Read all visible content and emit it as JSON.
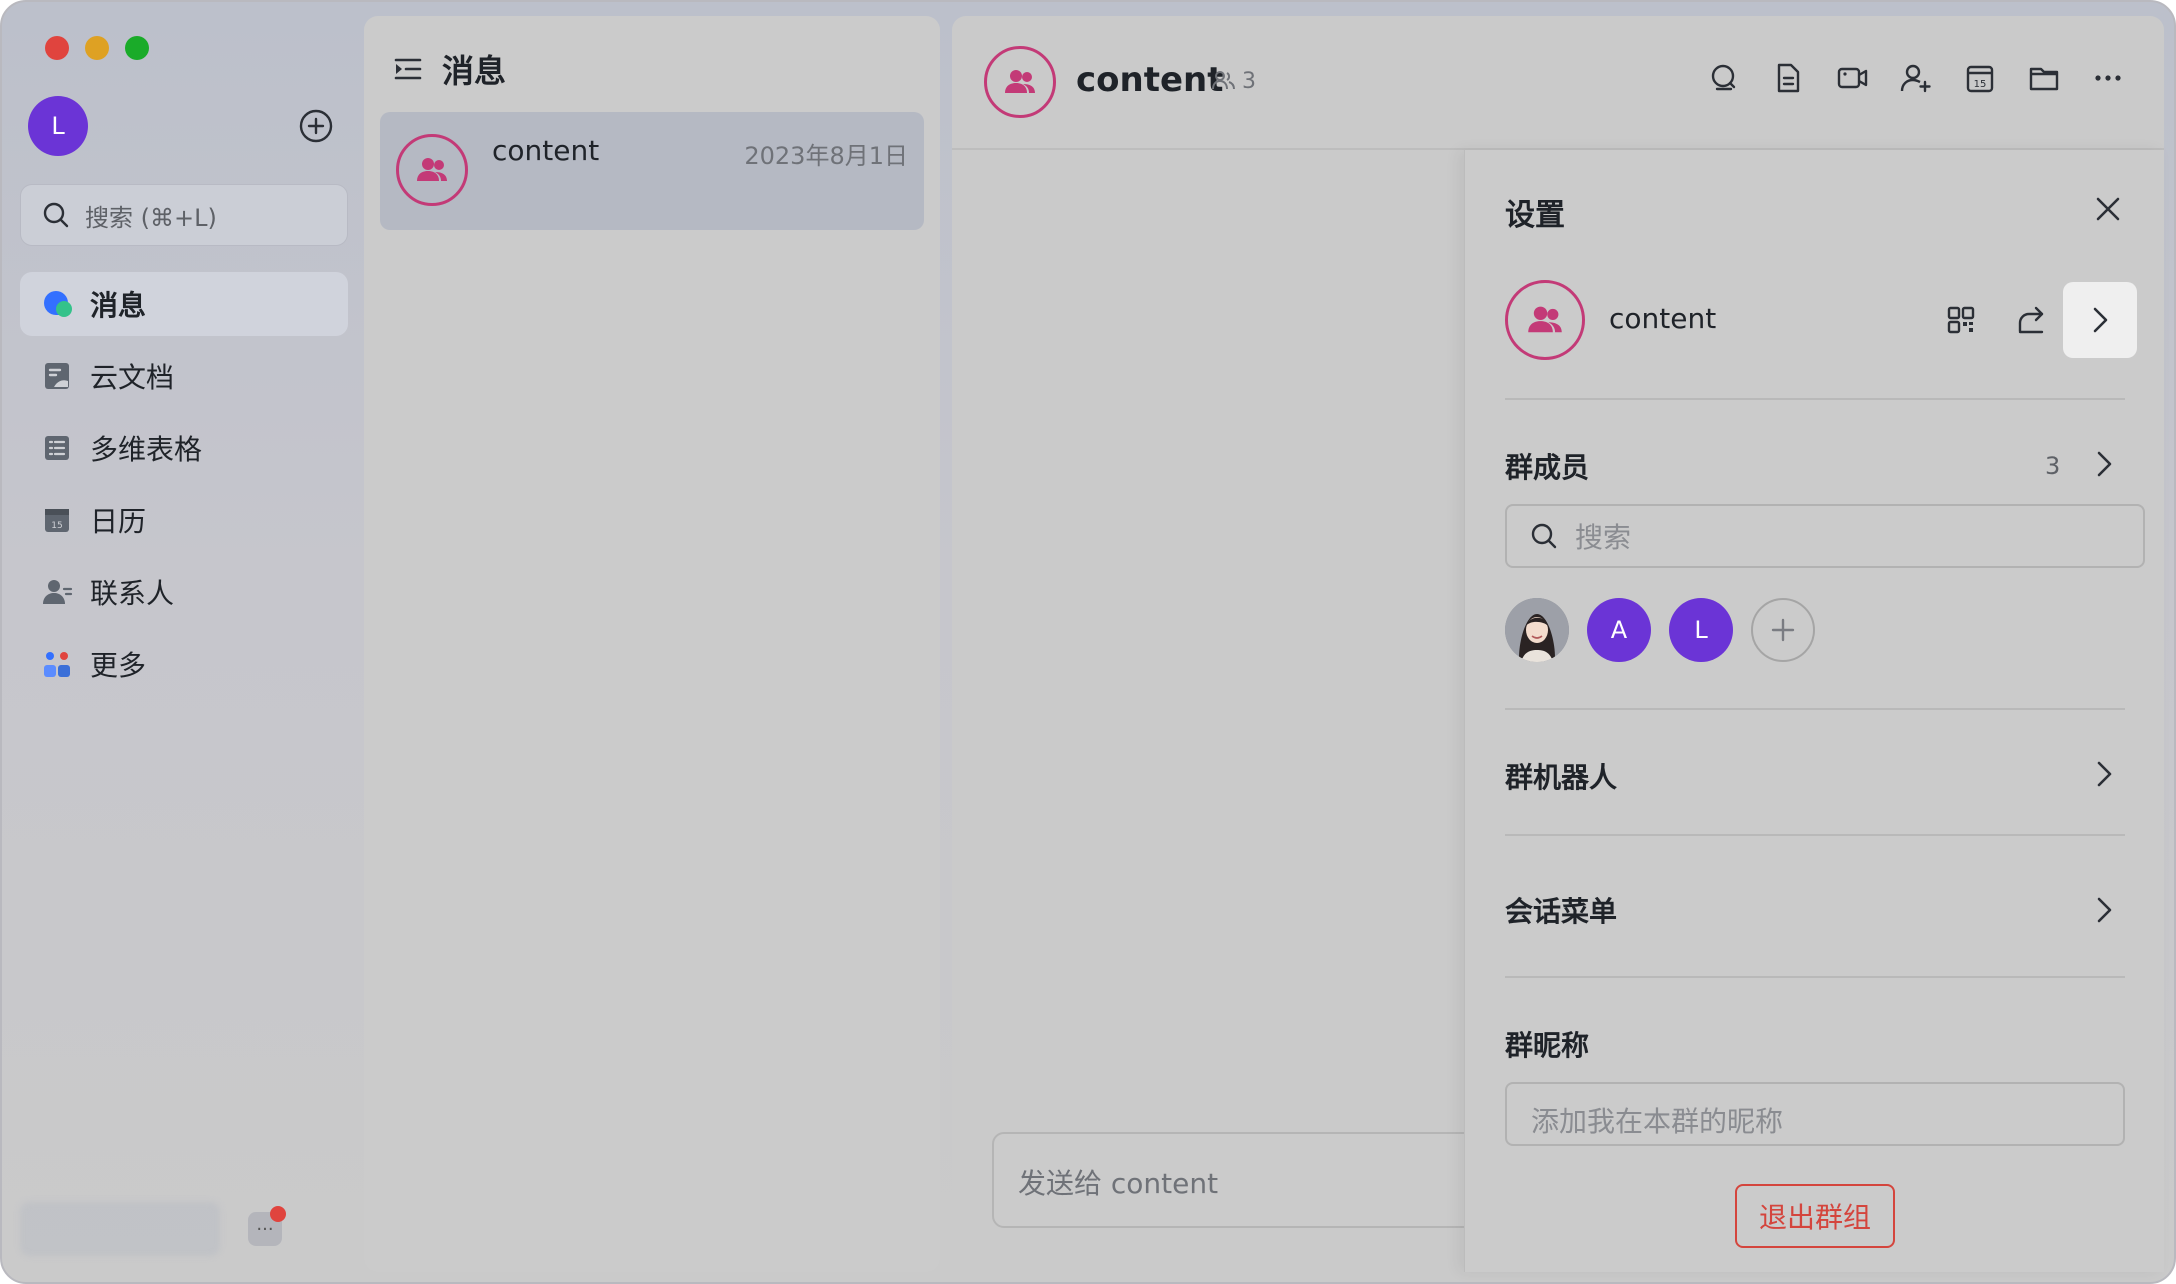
{
  "colors": {
    "accent_purple": "#6b34d6",
    "group_ring": "#c33a77",
    "danger": "#d4453d"
  },
  "sidebar": {
    "user_avatar_letter": "L",
    "search_placeholder": "搜索 (⌘+L)",
    "items": [
      {
        "label": "消息",
        "icon": "message-icon",
        "active": true
      },
      {
        "label": "云文档",
        "icon": "cloud-doc-icon",
        "active": false
      },
      {
        "label": "多维表格",
        "icon": "base-table-icon",
        "active": false
      },
      {
        "label": "日历",
        "icon": "calendar-icon",
        "active": false
      },
      {
        "label": "联系人",
        "icon": "contacts-icon",
        "active": false
      },
      {
        "label": "更多",
        "icon": "more-apps-icon",
        "active": false
      }
    ],
    "more_button": "···"
  },
  "message_list": {
    "title": "消息",
    "conversations": [
      {
        "name": "content",
        "date": "2023年8月1日"
      }
    ]
  },
  "chat": {
    "title": "content",
    "member_count": "3",
    "toolbar_icons": [
      "search-chat-icon",
      "doc-icon",
      "video-call-icon",
      "add-member-icon",
      "calendar-icon",
      "folder-icon",
      "more-icon"
    ],
    "composer_placeholder": "发送给 content"
  },
  "settings": {
    "title": "设置",
    "group_name": "content",
    "members_label": "群成员",
    "members_count": "3",
    "member_search_placeholder": "搜索",
    "member_avatars": [
      {
        "type": "photo",
        "label": ""
      },
      {
        "type": "letter",
        "label": "A"
      },
      {
        "type": "letter",
        "label": "L"
      }
    ],
    "bots_label": "群机器人",
    "menu_label": "会话菜单",
    "nickname_label": "群昵称",
    "nickname_placeholder": "添加我在本群的昵称",
    "leave_button": "退出群组"
  }
}
